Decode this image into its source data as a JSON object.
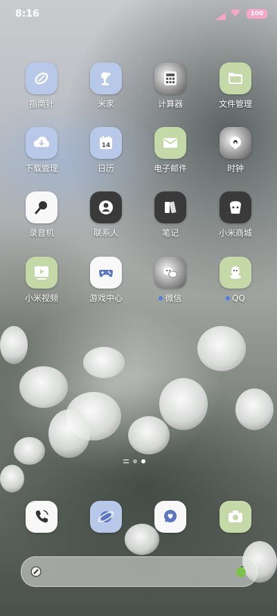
{
  "status_bar": {
    "time": "8:16",
    "battery": "100"
  },
  "apps": [
    {
      "label": "指南针",
      "icon": "compass-icon",
      "style": "blue"
    },
    {
      "label": "米家",
      "icon": "mijia-icon",
      "style": "blue"
    },
    {
      "label": "计算器",
      "icon": "calculator-icon",
      "style": "photo"
    },
    {
      "label": "文件管理",
      "icon": "folder-icon",
      "style": "green"
    },
    {
      "label": "下载管理",
      "icon": "download-icon",
      "style": "blue"
    },
    {
      "label": "日历",
      "icon": "calendar-icon",
      "style": "blue",
      "badge": "14"
    },
    {
      "label": "电子邮件",
      "icon": "mail-icon",
      "style": "green"
    },
    {
      "label": "时钟",
      "icon": "clock-icon",
      "style": "photo"
    },
    {
      "label": "录音机",
      "icon": "recorder-icon",
      "style": "white"
    },
    {
      "label": "联系人",
      "icon": "contacts-icon",
      "style": "dark"
    },
    {
      "label": "笔记",
      "icon": "notes-icon",
      "style": "dark"
    },
    {
      "label": "小米商城",
      "icon": "mall-icon",
      "style": "dark"
    },
    {
      "label": "小米视频",
      "icon": "video-icon",
      "style": "green"
    },
    {
      "label": "游戏中心",
      "icon": "gamepad-icon",
      "style": "white"
    },
    {
      "label": "微信",
      "icon": "wechat-icon",
      "style": "photo",
      "new": true
    },
    {
      "label": "QQ",
      "icon": "qq-icon",
      "style": "green",
      "new": true
    }
  ],
  "dock": [
    {
      "icon": "phone-icon",
      "style": "white"
    },
    {
      "icon": "browser-icon",
      "style": "blue"
    },
    {
      "icon": "messages-icon",
      "style": "white"
    },
    {
      "icon": "camera-icon",
      "style": "green"
    }
  ],
  "pager": {
    "pages": 2,
    "active": 2
  },
  "colors": {
    "blue_tile": "#b8c8e8",
    "green_tile": "#c4d8a8",
    "accent_dot": "#4d7be8",
    "battery": "#f6a7c8"
  }
}
